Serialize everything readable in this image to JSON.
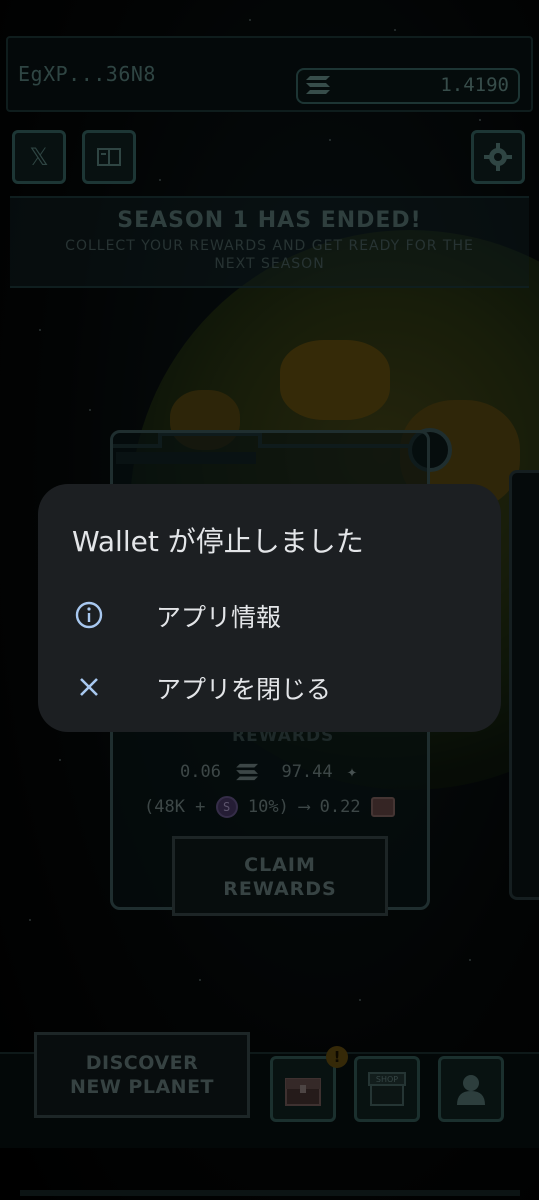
{
  "header": {
    "wallet_address": "EgXP...36N8",
    "balance": "1.4190"
  },
  "season_banner": {
    "title": "SEASON 1 HAS ENDED!",
    "subtitle_line1": "COLLECT YOUR REWARDS AND GET READY FOR THE",
    "subtitle_line2": "NEXT SEASON"
  },
  "rewards_card": {
    "label": "REWARDS",
    "sol_amount": "0.06",
    "star_amount": "97.44",
    "formula_prefix": "(48K +",
    "formula_pct": "10%)",
    "formula_result": "0.22",
    "claim_line1": "CLAIM",
    "claim_line2": "REWARDS"
  },
  "bottom_nav": {
    "discover_line1": "DISCOVER",
    "discover_line2": "NEW PLANET",
    "alert": "!",
    "shop_label": "SHOP"
  },
  "dialog": {
    "title": "Wallet が停止しました",
    "items": [
      {
        "label": "アプリ情報",
        "icon": "info-icon"
      },
      {
        "label": "アプリを閉じる",
        "icon": "close-icon"
      }
    ]
  },
  "colors": {
    "dialog_bg": "#1c1f22",
    "dialog_icon": "#a8c8f0",
    "dialog_text": "#e3e5e8",
    "game_accent": "#3a6d6a"
  }
}
